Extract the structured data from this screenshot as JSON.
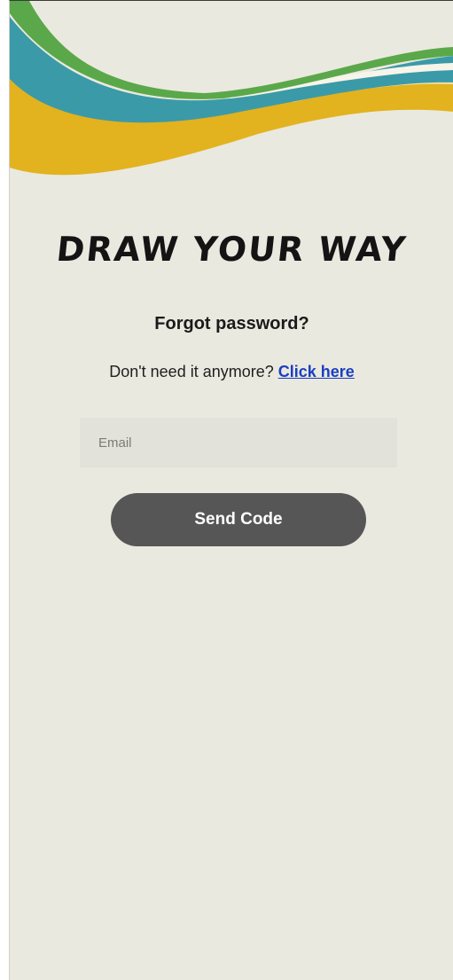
{
  "app": {
    "title": "DRAW YOUR WAY"
  },
  "form": {
    "heading": "Forgot password?",
    "hint_text": "Don't need it anymore? ",
    "hint_link": "Click here",
    "email_placeholder": "Email",
    "email_value": "",
    "submit_label": "Send Code"
  },
  "colors": {
    "background": "#eae9df",
    "wave_green": "#5aa84a",
    "wave_teal": "#3b9aa8",
    "wave_yellow": "#e2b21f",
    "button": "#565656",
    "link": "#1a3fc2",
    "input_bg": "#e2e1da"
  }
}
